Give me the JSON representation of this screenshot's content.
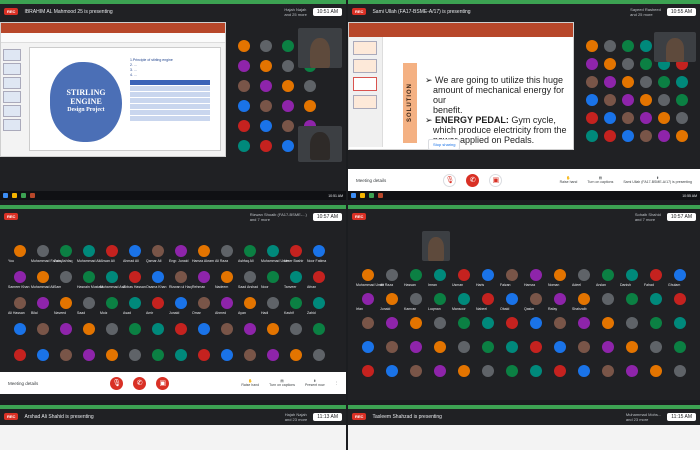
{
  "screens": {
    "tl": {
      "presenting": "IBRAHIM AL Mahmood 25 is presenting",
      "host": "Hajah Najah",
      "host_sub": "and 25 more",
      "clock": "10:51 AM",
      "slide_title_1": "STIRLING",
      "slide_title_2": "ENGINE",
      "slide_title_3": "Design Project",
      "outline": [
        "1.Principle of stirling engine",
        "2. ...",
        "3. ...",
        "4. ..."
      ],
      "taskbar_time": "10:51 AM"
    },
    "tr": {
      "presenting": "Sami Ullah (FA17-BSME-A/17) is presenting",
      "host": "Sayeed Rasheed",
      "host_sub": "and 25 more",
      "clock": "10:55 AM",
      "solution_label": "SOLUTION",
      "bullet1_a": "We are going to utilize this huge",
      "bullet1_b": "amount of mechanical energy for our",
      "bullet1_c": "benefit.",
      "bullet2_head": "ENERGY PEDAL:",
      "bullet2_a": "Gym cycle,",
      "bullet2_b": "which produce electricity from the",
      "bullet2_c": "power applied on Pedals.",
      "stop_sharing": "Stop sharing",
      "meeting_details": "Meeting details",
      "side_items": [
        "Raise hand",
        "Turn on captions",
        "Sami Ullah (FA17-BSME-A/17) is presenting"
      ],
      "taskbar_time": "10:55 AM"
    },
    "ml": {
      "presenting": "Rizwan Shoaib (FA17-BSME-...)",
      "host_sub": "and 7 more",
      "clock": "10:57 AM",
      "names": [
        "You",
        "Muhammad Farooq",
        "Zain Ashfaq",
        "Muhammad Ali",
        "Ahsan Ali",
        "Ahmad Ali",
        "Qamar Ali",
        "Engr. Junaid",
        "Hamza Akram",
        "Ali Raza",
        "Ashfaq Ali",
        "Muhammad Umer",
        "Umer Bashir",
        "Noor Fatima",
        "Sameer Khan",
        "Muhammad Ali",
        "Sam",
        "Hasnain Mustafa",
        "Muhammad Asif",
        "Abbas Hassan",
        "Osama Khan",
        "Rizwan ul Haq",
        "Rehman",
        "Nadeem",
        "Saad Arshad",
        "Noor",
        "Tanveer",
        "Afnan",
        "Ali Hassan",
        "Bilal",
        "Naveed",
        "Saad",
        "Moiz",
        "Asad",
        "Amir",
        "Junaid",
        "Omar",
        "Ahmed",
        "Ayan",
        "Hadi",
        "Kashif",
        "Zahid"
      ],
      "meeting_details": "Meeting details",
      "side_items": [
        "Raise hand",
        "Turn on captions",
        "Present now"
      ]
    },
    "mr": {
      "presenting": "Sohaib Shahid",
      "host_sub": "and 7 more",
      "clock": "10:57 AM",
      "names": [
        "Muhammad Umer",
        "Ali Raza",
        "Hassan",
        "Imran",
        "Usman",
        "Haris",
        "Faizan",
        "Hamza",
        "Noman",
        "Adeel",
        "Arslan",
        "Danish",
        "Fahad",
        "Ghulam",
        "Irfan",
        "Junaid",
        "Kamran",
        "Luqman",
        "Mansoor",
        "Nabeel",
        "Obaid",
        "Qasim",
        "Rafay",
        "Shahzaib"
      ]
    },
    "bl": {
      "presenting": "Arshad Ali Shahid is presenting",
      "host": "Hajah Najah",
      "host_sub": "and 23 more",
      "clock": "11:13 AM"
    },
    "br": {
      "presenting": "Tasleem Shahzad is presenting",
      "host": "Muhammad Mohs...",
      "host_sub": "and 23 more",
      "clock": "11:15 AM"
    }
  },
  "colors": {
    "meet_green": "#3ca252",
    "meet_dark": "#202124",
    "rec_red": "#d93025",
    "ppt_red": "#b7472a",
    "avatar_palette": [
      "#e37400",
      "#1a73e8",
      "#0b8043",
      "#8e24aa",
      "#c5221f",
      "#5f6368",
      "#795548",
      "#00897b"
    ]
  }
}
